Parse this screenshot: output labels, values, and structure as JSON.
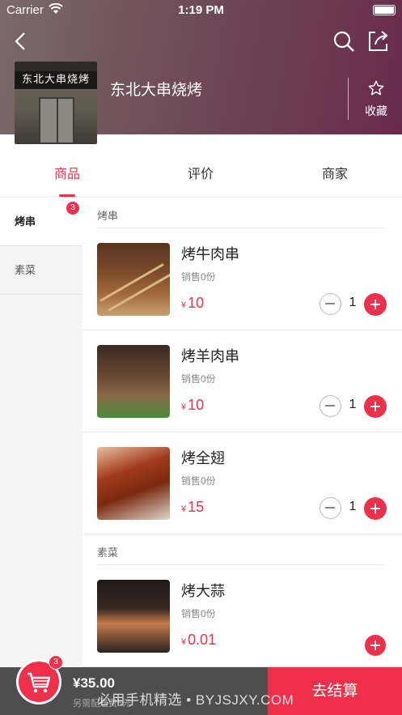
{
  "status_bar": {
    "carrier": "Carrier",
    "time": "1:19 PM"
  },
  "header": {
    "back_icon": "chevron-left-icon",
    "search_icon": "search-icon",
    "share_icon": "share-icon",
    "logo_sign": "东北大串烧烤",
    "shop_name": "东北大串烧烤",
    "favorite_label": "收藏",
    "favorite_icon": "star-outline-icon"
  },
  "tabs": [
    {
      "label": "商品",
      "active": true
    },
    {
      "label": "评价",
      "active": false
    },
    {
      "label": "商家",
      "active": false
    }
  ],
  "sidebar": [
    {
      "label": "烤串",
      "badge": "3",
      "active": true
    },
    {
      "label": "素菜",
      "badge": "",
      "active": false
    }
  ],
  "categories": [
    {
      "title": "烤串",
      "items": [
        {
          "name": "烤牛肉串",
          "sales": "销售0份",
          "currency": "¥",
          "price": "10",
          "qty": "1"
        },
        {
          "name": "烤羊肉串",
          "sales": "销售0份",
          "currency": "¥",
          "price": "10",
          "qty": "1"
        },
        {
          "name": "烤全翅",
          "sales": "销售0份",
          "currency": "¥",
          "price": "15",
          "qty": "1"
        }
      ]
    },
    {
      "title": "素菜",
      "items": [
        {
          "name": "烤大蒜",
          "sales": "销售0份",
          "currency": "¥",
          "price": "0.01",
          "qty": ""
        }
      ]
    }
  ],
  "cart": {
    "badge": "3",
    "total": "¥35.00",
    "delivery_note": "另需配送费5元",
    "checkout_label": "去结算",
    "watermark": "必用手机精选 • BYJSJXY.COM"
  },
  "colors": {
    "accent": "#f0304a",
    "bar": "#4e4e4e"
  }
}
